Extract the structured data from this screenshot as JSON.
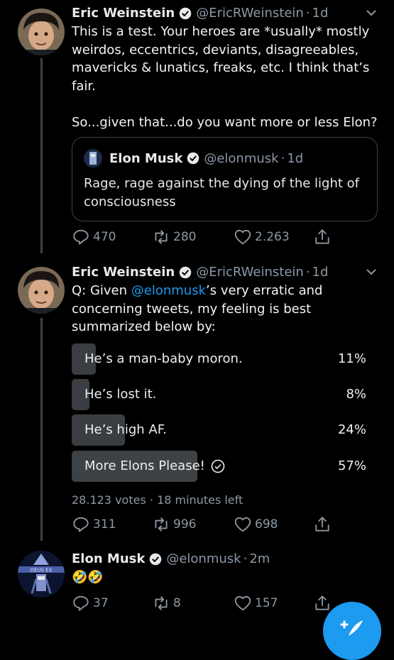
{
  "tweets": [
    {
      "name": "Eric Weinstein",
      "handle": "@EricRWeinstein",
      "dot": "·",
      "time": "1d",
      "text": "This is a test. Your heroes are *usually* mostly weirdos, eccentrics, deviants, disagreeables, mavericks & lunatics, freaks, etc. I think that’s fair.\n\nSo...given that...do you want more or less Elon?",
      "quote": {
        "name": "Elon Musk",
        "handle": "@elonmusk",
        "dot": "·",
        "time": "1d",
        "text": "Rage, rage against the dying of the light of consciousness"
      },
      "replies": "470",
      "retweets": "280",
      "likes": "2.263"
    },
    {
      "name": "Eric Weinstein",
      "handle": "@EricRWeinstein",
      "dot": "·",
      "time": "1d",
      "text_before": "Q: Given ",
      "mention": "@elonmusk",
      "text_after": "’s very erratic and concerning tweets, my feeling is best summarized below by:",
      "poll": {
        "options": [
          {
            "label": "He’s a man-baby moron.",
            "percent": "11%",
            "fraction": 0.11
          },
          {
            "label": "He’s lost it.",
            "percent": "8%",
            "fraction": 0.08
          },
          {
            "label": "He’s high AF.",
            "percent": "24%",
            "fraction": 0.24
          },
          {
            "label": "More Elons Please!",
            "percent": "57%",
            "fraction": 0.57,
            "winner": true
          }
        ],
        "votes": "28.123 votes",
        "dot": "·",
        "time_left": "18 minutes left"
      },
      "replies": "311",
      "retweets": "996",
      "likes": "698"
    },
    {
      "name": "Elon Musk",
      "handle": "@elonmusk",
      "dot": "·",
      "time": "2m",
      "text": "🤣🤣",
      "avatar_caption": "DEUS EX",
      "replies": "37",
      "retweets": "8",
      "likes": "157"
    }
  ],
  "icons": {
    "verified": "verified-badge-icon",
    "reply": "reply-icon",
    "retweet": "retweet-icon",
    "like": "like-icon",
    "share": "share-icon",
    "caret": "chevron-down-icon",
    "compose": "compose-icon"
  },
  "colors": {
    "background": "#000000",
    "accent": "#1d9bf0",
    "secondary_text": "#8b98a5",
    "poll_bar": "#3a3e42"
  }
}
